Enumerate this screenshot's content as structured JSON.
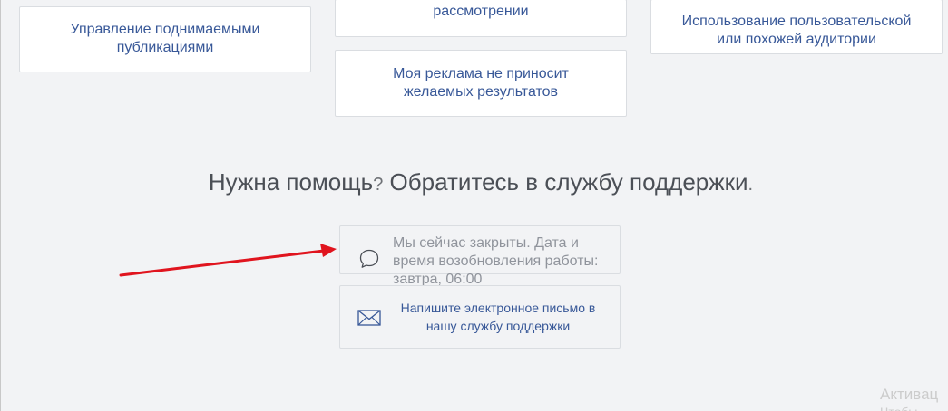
{
  "help_cards": [
    {
      "label": "Управление поднимаемыми публикациями"
    },
    {
      "label": "рассмотрении"
    },
    {
      "label": "Использование пользовательской или похожей аудитории"
    },
    {
      "label": "Моя реклама не приносит желаемых результатов"
    }
  ],
  "support": {
    "heading_part1": "Нужна помощь",
    "heading_q": "?",
    "heading_part2": " Обратитесь в службу поддержки",
    "heading_dot": ".",
    "chat_status": "Мы сейчас закрыты. Дата и время возобновления работы: завтра, 06:00",
    "email_label": "Напишите электронное письмо в нашу службу поддержки"
  },
  "watermark": {
    "line1": "Активац",
    "line2": "Чтобы"
  },
  "colors": {
    "link": "#385898",
    "background": "#f2f3f5",
    "card_border": "#dadde1",
    "heading": "#4b4f56",
    "muted": "#90949c",
    "annotation_arrow": "#e0141e"
  },
  "icons": {
    "chat": "chat-bubble-icon",
    "email": "envelope-icon",
    "annotation": "red-arrow-annotation"
  }
}
